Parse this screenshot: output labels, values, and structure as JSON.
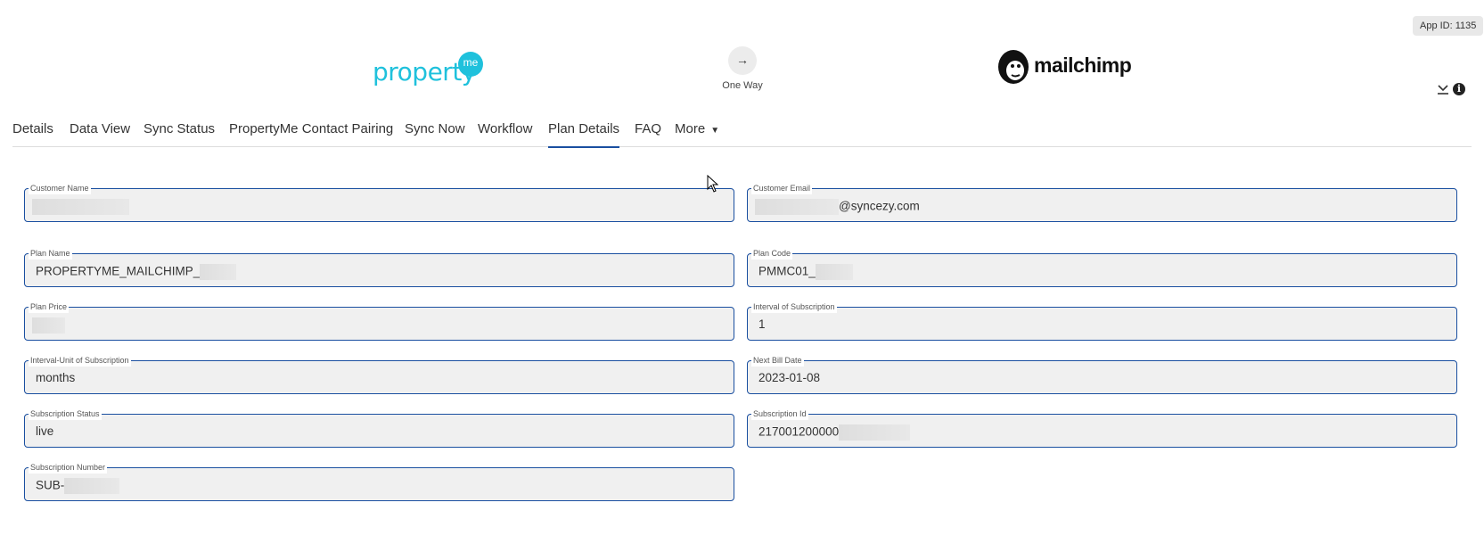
{
  "header": {
    "app_id": "App ID: 1135",
    "source_logo": {
      "word": "property",
      "badge": "me",
      "color": "#1fc1dc"
    },
    "direction_icon": "arrow-right-icon",
    "direction_label": "One Way",
    "target_logo": {
      "text": "mailchimp"
    },
    "icons": [
      "download-chevron-icon",
      "info-icon"
    ]
  },
  "tabs": [
    {
      "label": "Details"
    },
    {
      "label": "Data View"
    },
    {
      "label": "Sync Status"
    },
    {
      "label": "PropertyMe Contact Pairing"
    },
    {
      "label": "Sync Now"
    },
    {
      "label": "Workflow"
    },
    {
      "label": "Plan Details",
      "active": true
    },
    {
      "label": "FAQ"
    },
    {
      "label": "More"
    }
  ],
  "fields": {
    "customer_name": {
      "label": "Customer Name",
      "value": ""
    },
    "customer_email": {
      "label": "Customer Email",
      "value": "@syncezy.com"
    },
    "plan_name": {
      "label": "Plan Name",
      "value": "PROPERTYME_MAILCHIMP_"
    },
    "plan_code": {
      "label": "Plan Code",
      "value": "PMMC01_"
    },
    "plan_price": {
      "label": "Plan Price",
      "value": ""
    },
    "interval": {
      "label": "Interval of Subscription",
      "value": "1"
    },
    "interval_unit": {
      "label": "Interval-Unit of Subscription",
      "value": "months"
    },
    "next_bill_date": {
      "label": "Next Bill Date",
      "value": "2023-01-08"
    },
    "subscription_status": {
      "label": "Subscription Status",
      "value": "live"
    },
    "subscription_id": {
      "label": "Subscription Id",
      "value": "217001200000"
    },
    "subscription_number": {
      "label": "Subscription Number",
      "value": "SUB-"
    }
  },
  "colors": {
    "accent": "#1a4fa0",
    "brand_propertyme": "#1fc1dc",
    "field_bg": "#f0f0f0"
  }
}
